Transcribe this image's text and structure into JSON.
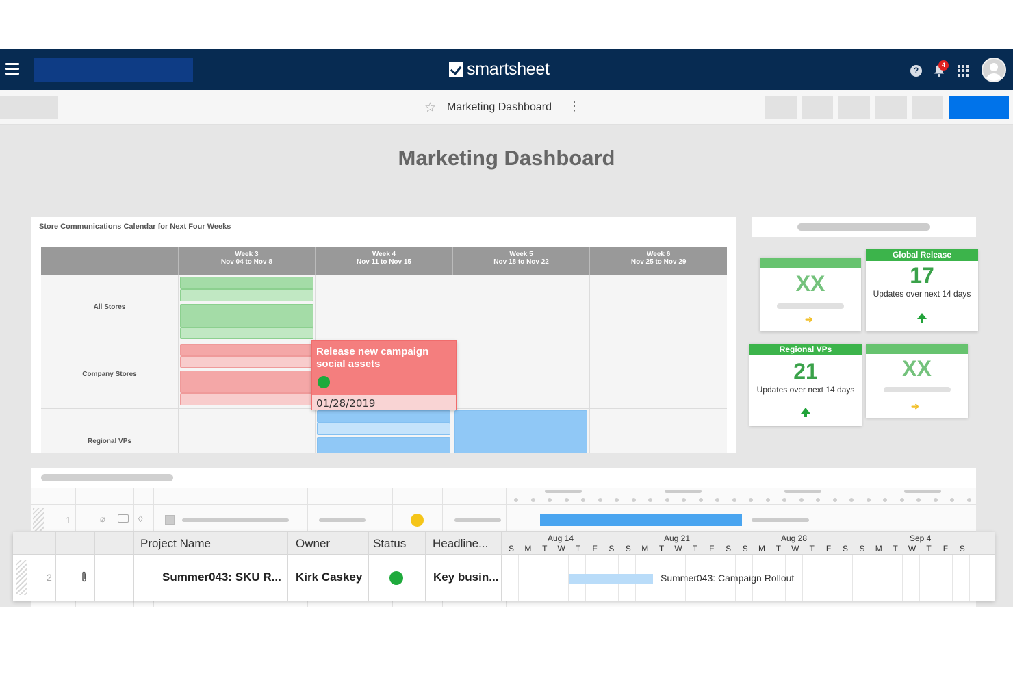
{
  "app": {
    "logo_text": "smartsheet",
    "notification_count": "4",
    "help_glyph": "?"
  },
  "toolbar": {
    "sheet_title": "Marketing Dashboard",
    "star_glyph": "☆",
    "more_glyph": "⋮"
  },
  "dashboard": {
    "title": "Marketing Dashboard"
  },
  "calendar": {
    "title": "Store Communications Calendar for Next Four Weeks",
    "weeks": [
      {
        "label": "Week 3",
        "range": "Nov 04 to Nov 8"
      },
      {
        "label": "Week 4",
        "range": "Nov 11 to Nov 15"
      },
      {
        "label": "Week 5",
        "range": "Nov 18 to Nov 22"
      },
      {
        "label": "Week 6",
        "range": "Nov 25 to Nov 29"
      }
    ],
    "rows": [
      "All Stores",
      "Company Stores",
      "Regional VPs"
    ],
    "popup": {
      "title": "Release new campaign social assets",
      "date": "01/28/2019",
      "status_color": "#1faa3c"
    }
  },
  "metrics": [
    {
      "header": "",
      "value": "XX",
      "subtitle": "",
      "trend": "flat"
    },
    {
      "header": "Global Release",
      "value": "17",
      "subtitle": "Updates over next 14 days",
      "trend": "up"
    },
    {
      "header": "Regional VPs",
      "value": "21",
      "subtitle": "Updates over next 14 days",
      "trend": "up"
    },
    {
      "header": "",
      "value": "XX",
      "subtitle": "",
      "trend": "flat"
    }
  ],
  "sheet": {
    "row1_number": "1",
    "row1_status_color": "#f5c518",
    "columns": [
      "Project Name",
      "Owner",
      "Status",
      "Headline..."
    ],
    "row2": {
      "number": "2",
      "project_name": "Summer043: SKU R...",
      "owner": "Kirk Caskey",
      "status_color": "#1faa3c",
      "headline": "Key busin...",
      "gantt_label": "Summer043: Campaign Rollout"
    },
    "gantt_weeks": [
      "Aug 14",
      "Aug 21",
      "Aug 28",
      "Sep 4"
    ],
    "gantt_days": [
      "S",
      "M",
      "T",
      "W",
      "T",
      "F",
      "S",
      "S",
      "M",
      "T",
      "W",
      "T",
      "F",
      "S",
      "S",
      "M",
      "T",
      "W",
      "T",
      "F",
      "S",
      "S",
      "M",
      "T",
      "W",
      "T",
      "F",
      "S"
    ]
  },
  "colors": {
    "topbar": "#072b52",
    "primary_button": "#0073ea",
    "green": "#3cb44b",
    "red_event": "#f47e7e",
    "blue_event": "#90c8f6"
  }
}
